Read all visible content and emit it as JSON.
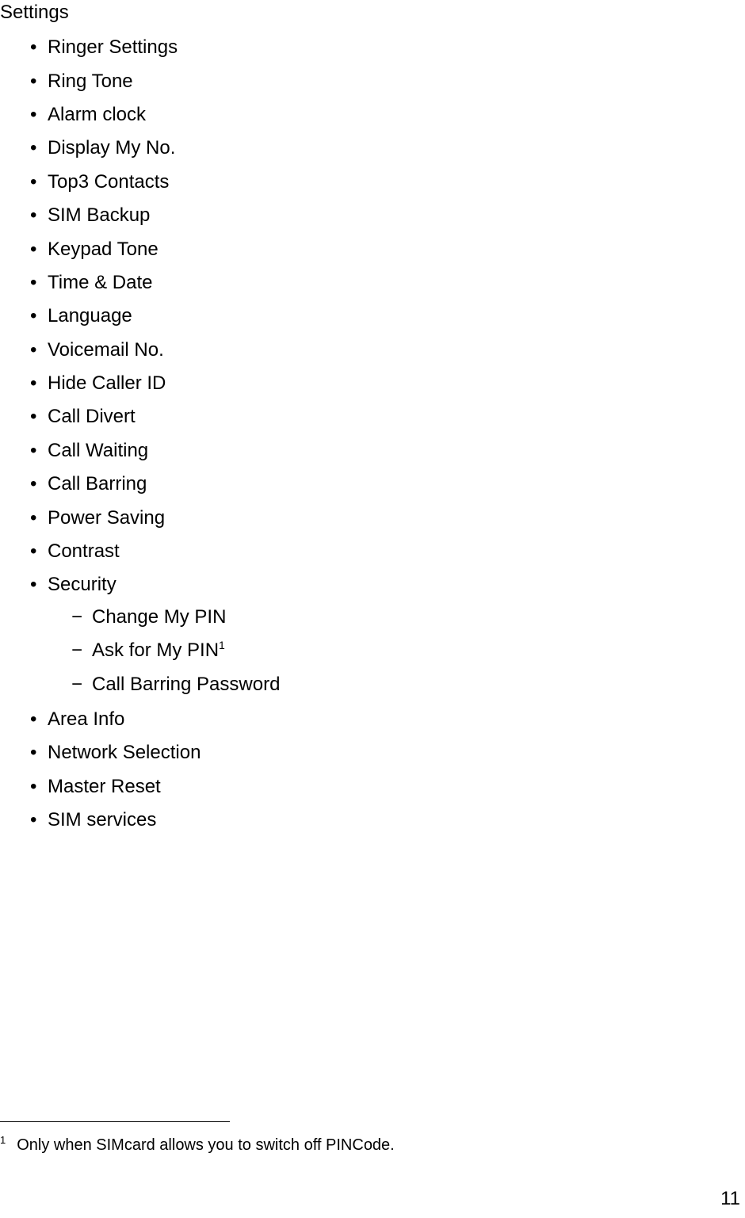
{
  "heading": "Settings",
  "items": [
    {
      "label": "Ringer Settings"
    },
    {
      "label": "Ring Tone"
    },
    {
      "label": "Alarm clock"
    },
    {
      "label": "Display My No."
    },
    {
      "label": "Top3 Contacts"
    },
    {
      "label": "SIM Backup"
    },
    {
      "label": "Keypad Tone"
    },
    {
      "label": "Time & Date"
    },
    {
      "label": "Language"
    },
    {
      "label": "Voicemail No."
    },
    {
      "label": "Hide Caller ID"
    },
    {
      "label": "Call Divert"
    },
    {
      "label": "Call Waiting"
    },
    {
      "label": "Call Barring"
    },
    {
      "label": "Power Saving"
    },
    {
      "label": "Contrast"
    },
    {
      "label": "Security",
      "children": [
        {
          "label": "Change My PIN"
        },
        {
          "label": "Ask for My PIN",
          "sup": "1"
        },
        {
          "label": "Call Barring Password"
        }
      ]
    },
    {
      "label": "Area Info"
    },
    {
      "label": "Network Selection"
    },
    {
      "label": "Master Reset"
    },
    {
      "label": "SIM services"
    }
  ],
  "footnote": {
    "mark": "1",
    "text": "Only when SIMcard allows you to switch off PINCode."
  },
  "page_number": "11"
}
